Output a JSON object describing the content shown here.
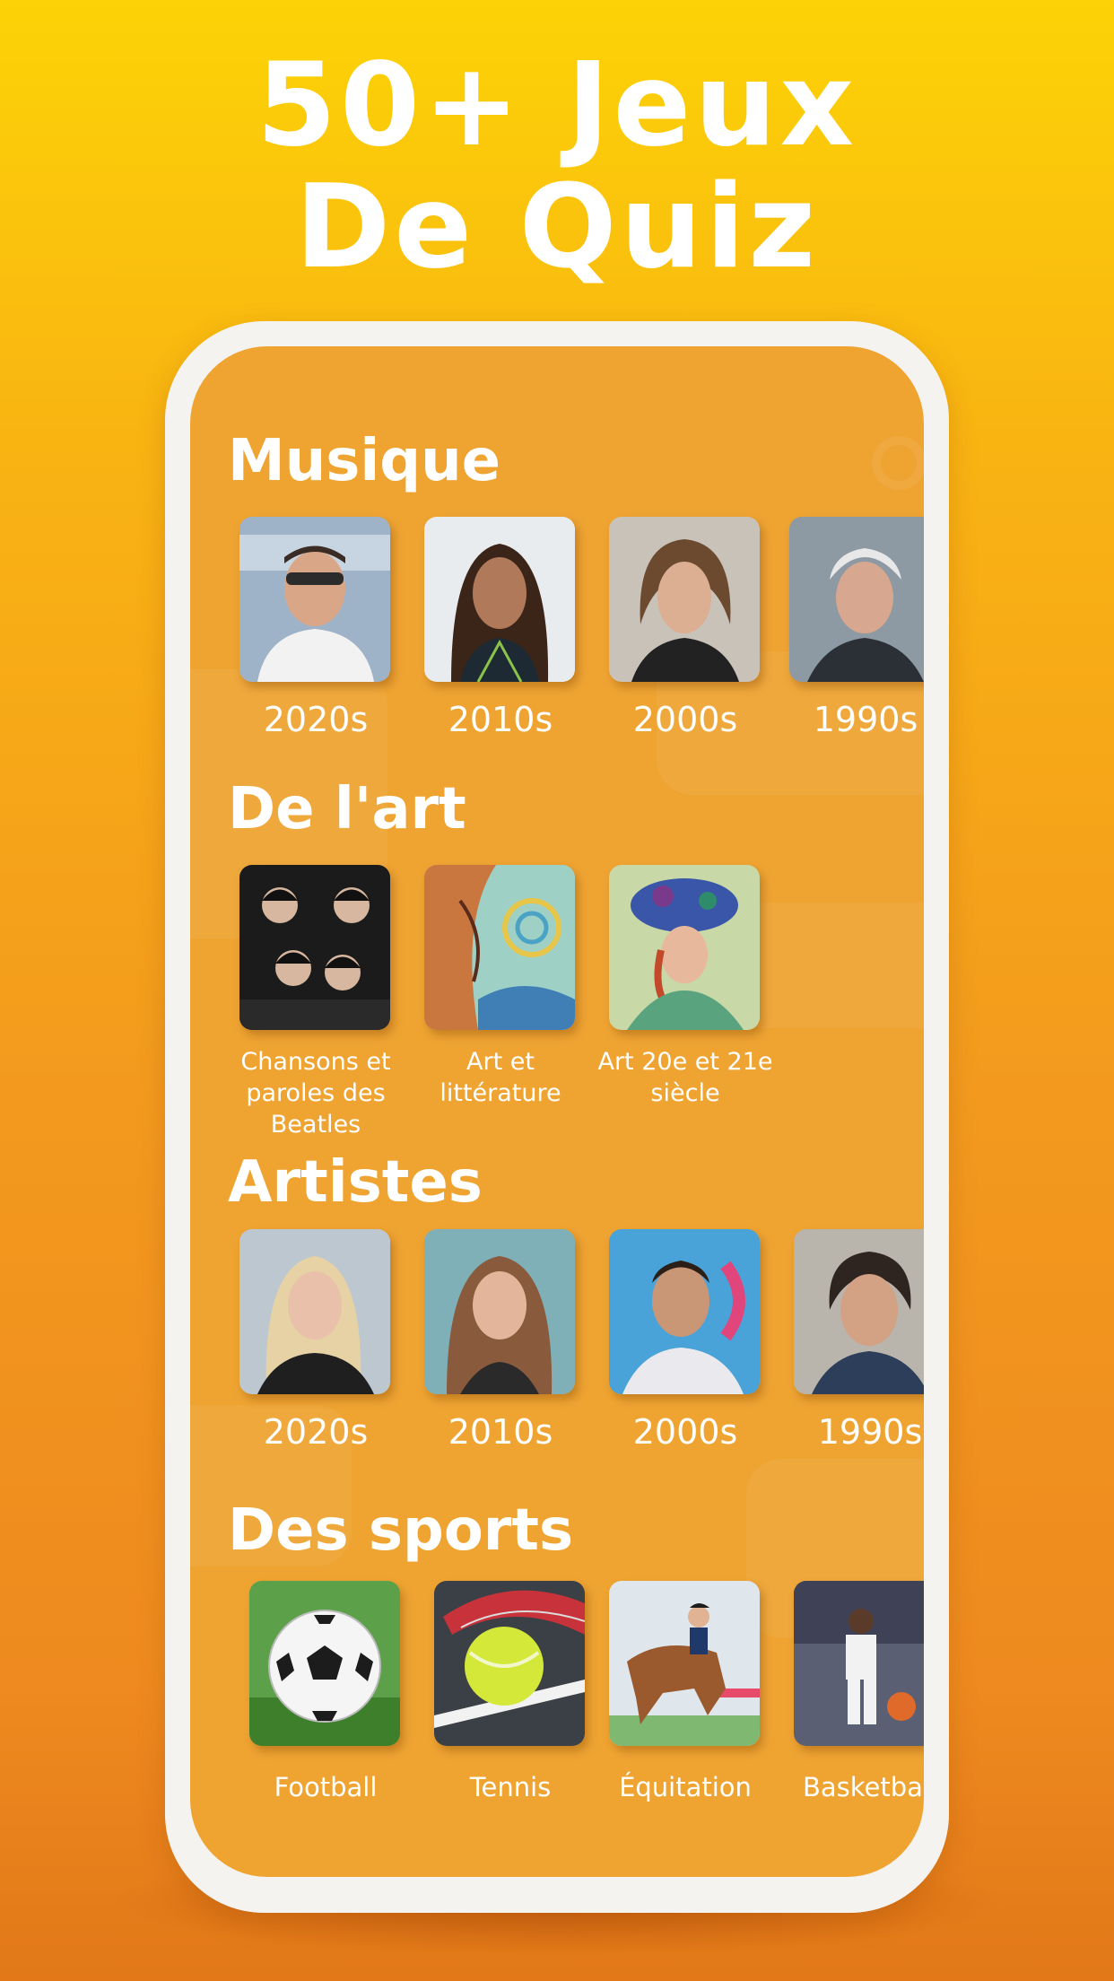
{
  "headline": {
    "line1": "50+ Jeux",
    "line2": "De Quiz"
  },
  "sections": [
    {
      "title": "Musique",
      "items": [
        {
          "label": "2020s"
        },
        {
          "label": "2010s"
        },
        {
          "label": "2000s"
        },
        {
          "label": "1990s"
        }
      ]
    },
    {
      "title": "De l'art",
      "items": [
        {
          "label": "Chansons et paroles des Beatles"
        },
        {
          "label": "Art et littérature"
        },
        {
          "label": "Art 20e et 21e siècle"
        }
      ]
    },
    {
      "title": "Artistes",
      "items": [
        {
          "label": "2020s"
        },
        {
          "label": "2010s"
        },
        {
          "label": "2000s"
        },
        {
          "label": "1990s"
        }
      ]
    },
    {
      "title": "Des sports",
      "items": [
        {
          "label": "Football"
        },
        {
          "label": "Tennis"
        },
        {
          "label": "Équitation"
        },
        {
          "label": "Basketball"
        }
      ]
    }
  ],
  "colors": {
    "background_top": "#fcd306",
    "background_bottom": "#e27818",
    "screen": "#efa432",
    "text": "#ffffff"
  }
}
